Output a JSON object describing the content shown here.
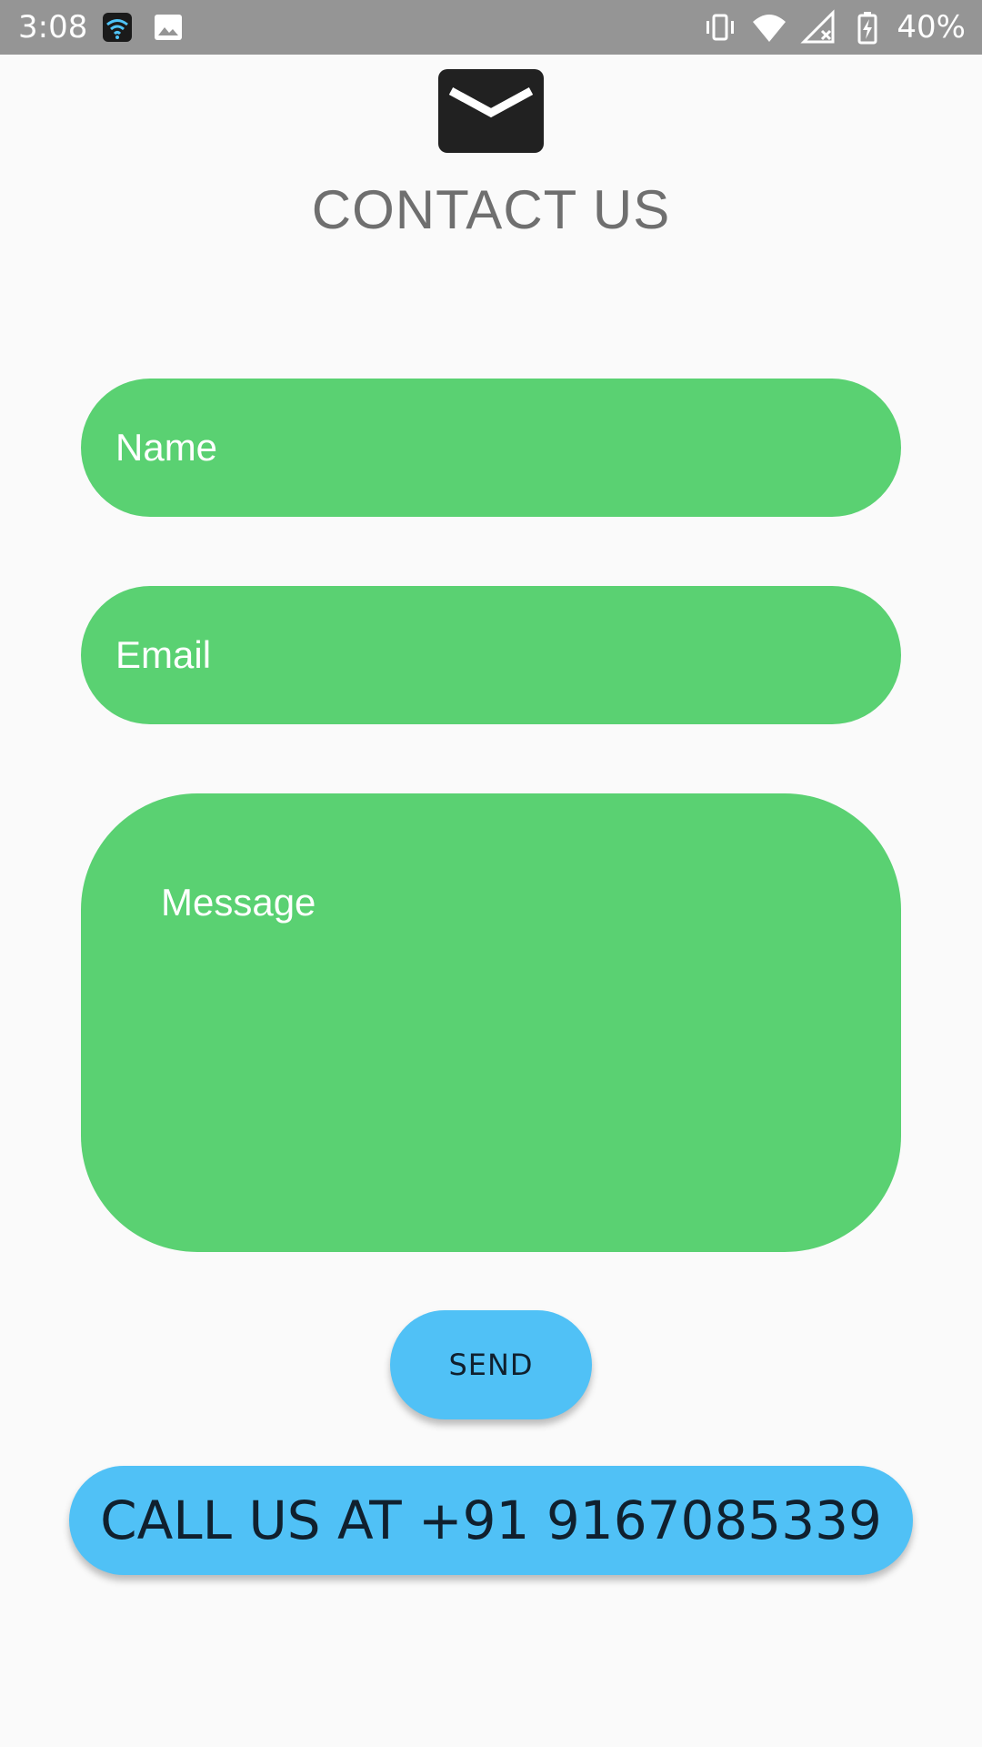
{
  "status_bar": {
    "time": "3:08",
    "battery": "40%",
    "icons": [
      "wifi-square-icon",
      "image-icon",
      "vibrate-icon",
      "wifi-icon",
      "signal-icon",
      "battery-charging-icon"
    ]
  },
  "header": {
    "icon": "mail-icon",
    "title": "CONTACT US"
  },
  "form": {
    "name_placeholder": "Name",
    "email_placeholder": "Email",
    "message_placeholder": "Message",
    "field_color": "#5ad172"
  },
  "actions": {
    "send_label": "SEND",
    "call_label": "CALL US AT +91 9167085339",
    "button_color": "#50c1f6"
  }
}
